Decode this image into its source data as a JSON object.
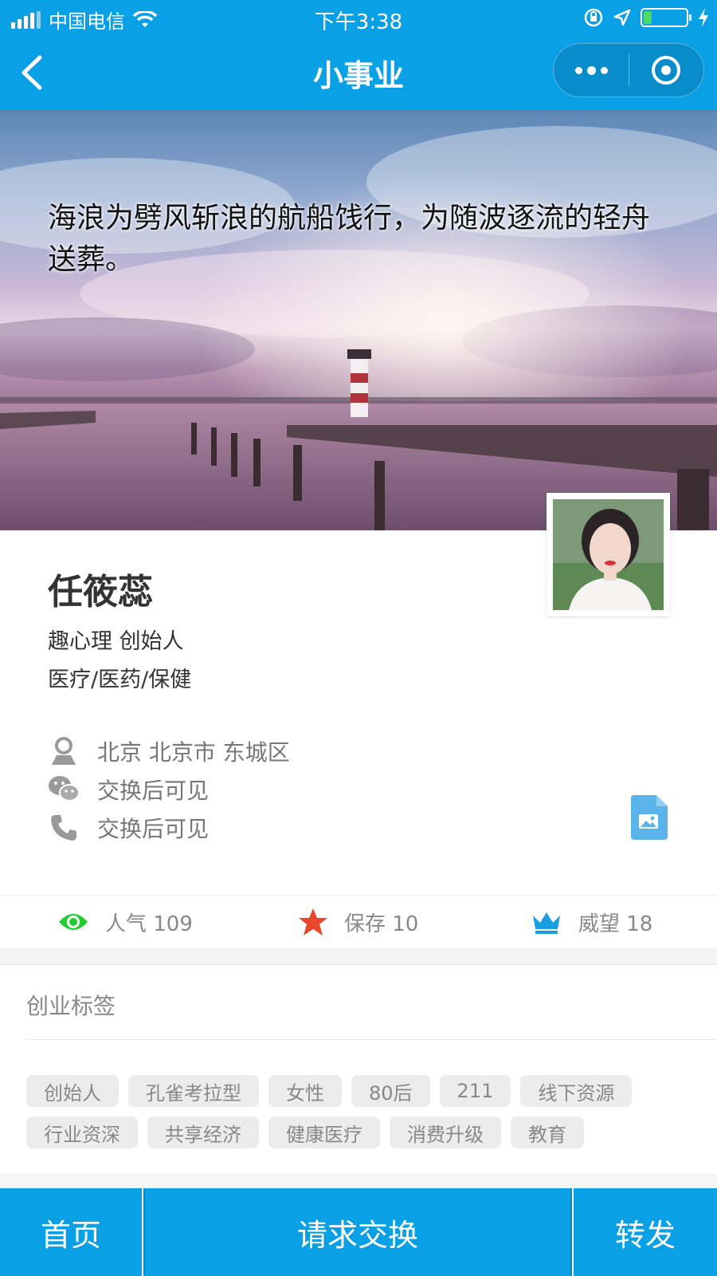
{
  "status_bar": {
    "carrier": "中国电信",
    "time": "下午3:38",
    "battery_level": 0.2
  },
  "nav": {
    "title": "小事业"
  },
  "banner": {
    "quote": "海浪为劈风斩浪的航船饯行，为随波逐流的轻舟送葬。"
  },
  "profile": {
    "name": "任筱蕊",
    "role": "趣心理 创始人",
    "industry": "医疗/医药/保健",
    "location": "北京 北京市 东城区",
    "wechat": "交换后可见",
    "phone": "交换后可见"
  },
  "stats": {
    "popularity": "人气 109",
    "saved": "保存 10",
    "prestige": "威望 18"
  },
  "tags_section": {
    "title": "创业标签",
    "tags": [
      "创始人",
      "孔雀考拉型",
      "女性",
      "80后",
      "211",
      "线下资源",
      "行业资深",
      "共享经济",
      "健康医疗",
      "消费升级",
      "教育"
    ]
  },
  "bottom_bar": {
    "home": "首页",
    "request": "请求交换",
    "share": "转发"
  },
  "colors": {
    "primary": "#0aa0e6",
    "eye_icon": "#22cc33",
    "star_icon": "#e8472a",
    "crown_icon": "#1a9ee0"
  }
}
